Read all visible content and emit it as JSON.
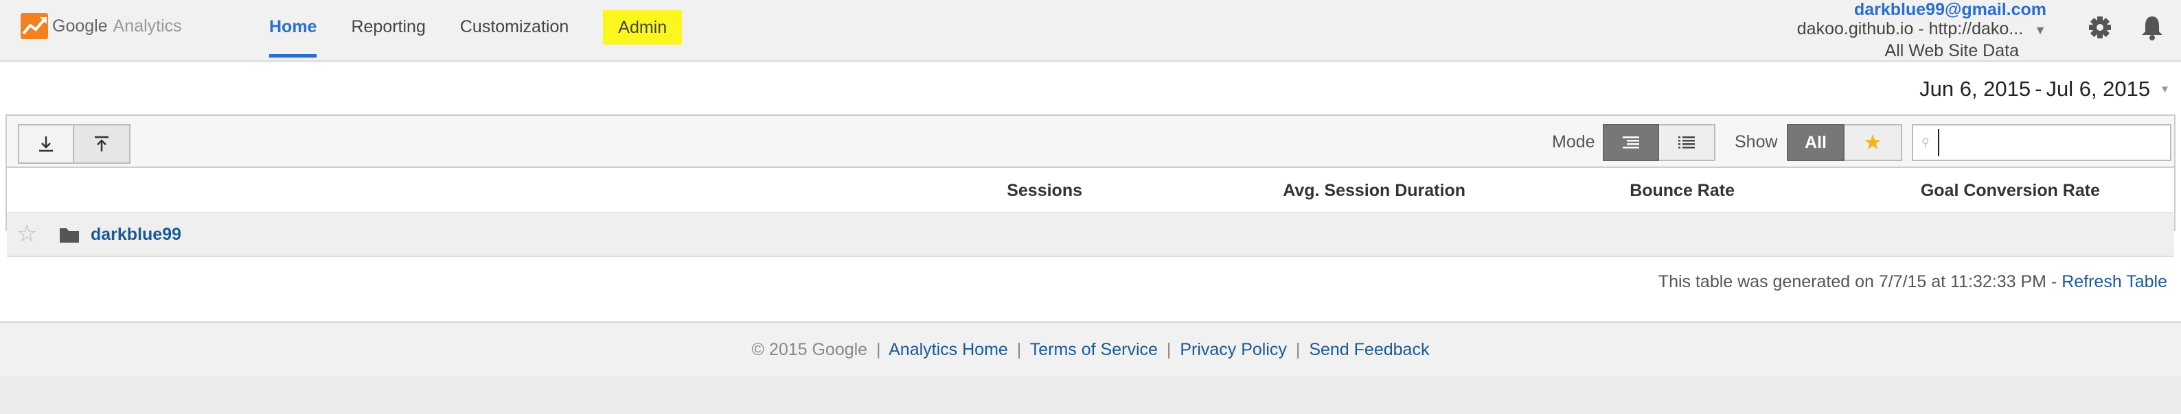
{
  "app": {
    "logo_google": "Google",
    "logo_analytics": "Analytics"
  },
  "nav": {
    "home": "Home",
    "reporting": "Reporting",
    "customization": "Customization",
    "admin": "Admin"
  },
  "account": {
    "email": "darkblue99@gmail.com",
    "property": "dakoo.github.io - http://dako...",
    "view": "All Web Site Data"
  },
  "date_range": {
    "start": "Jun 6, 2015",
    "separator": "-",
    "end": "Jul 6, 2015"
  },
  "toolbar": {
    "mode_label": "Mode",
    "show_label": "Show",
    "show_all": "All",
    "star_glyph": "★",
    "search_value": ""
  },
  "table": {
    "columns": {
      "sessions": "Sessions",
      "avg_session_duration": "Avg. Session Duration",
      "bounce_rate": "Bounce Rate",
      "goal_conversion_rate": "Goal Conversion Rate"
    },
    "rows": [
      {
        "name": "darkblue99",
        "star_glyph": "☆"
      }
    ],
    "generated_text": "This table was generated on 7/7/15 at 11:32:33 PM - ",
    "refresh_label": "Refresh Table"
  },
  "footer": {
    "copyright": "© 2015 Google",
    "links": {
      "analytics_home": "Analytics Home",
      "terms": "Terms of Service",
      "privacy": "Privacy Policy",
      "feedback": "Send Feedback"
    },
    "separator": "|"
  },
  "colors": {
    "accent_blue": "#2a6ed3",
    "link_blue": "#1a5a96",
    "admin_highlight": "#fbf71d",
    "star_gold": "#f2b41c"
  },
  "icons": {
    "logo": "analytics-logo-icon",
    "account_caret": "caret-down-icon",
    "settings": "gear-icon",
    "notifications": "bell-icon",
    "download": "download-icon",
    "upload": "upload-icon",
    "mode_tree": "tree-view-icon",
    "mode_list": "list-view-icon",
    "search": "search-icon",
    "folder": "folder-icon"
  }
}
